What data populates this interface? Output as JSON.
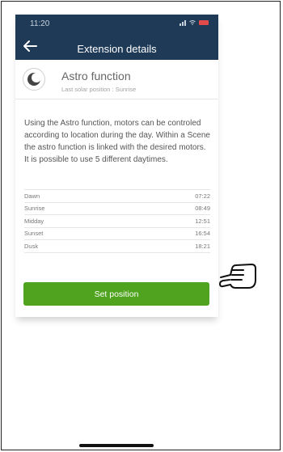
{
  "status_bar": {
    "time": "11:20"
  },
  "app_bar": {
    "title": "Extension details"
  },
  "extension": {
    "name": "Astro function",
    "subtitle": "Last solar position : Sunrise"
  },
  "description": [
    "Using the Astro function, motors can be controled according to location during the day. Within a Scene the astro function is linked with the desired motors.",
    "It is possible to use 5 different daytimes."
  ],
  "daytimes": [
    {
      "label": "Dawn",
      "time": "07:22"
    },
    {
      "label": "Sunrise",
      "time": "08:49"
    },
    {
      "label": "Midday",
      "time": "12:51"
    },
    {
      "label": "Sunset",
      "time": "16:54"
    },
    {
      "label": "Dusk",
      "time": "18:21"
    }
  ],
  "actions": {
    "set_position_label": "Set position"
  },
  "colors": {
    "app_bar_bg": "#1f3a57",
    "button_green": "#4fa31e",
    "battery_red": "#e04a4a"
  },
  "icons": [
    "back-arrow-icon",
    "astro-moon-icon",
    "signal-icon",
    "wifi-icon",
    "battery-icon",
    "pointing-hand-icon"
  ]
}
